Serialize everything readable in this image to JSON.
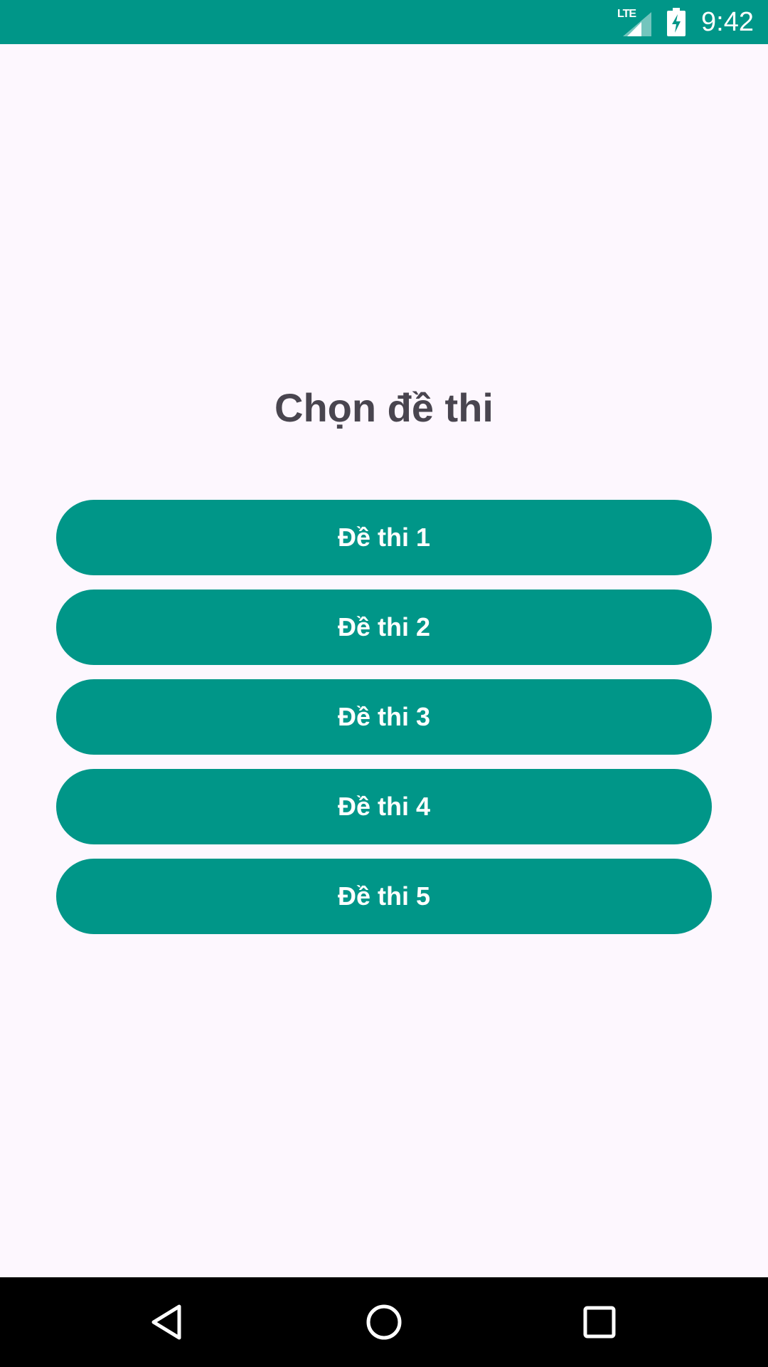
{
  "status_bar": {
    "network_label": "LTE",
    "time": "9:42",
    "color": "#009688"
  },
  "screen": {
    "title": "Chọn đề thi",
    "buttons": [
      {
        "label": "Đề thi 1"
      },
      {
        "label": "Đề thi 2"
      },
      {
        "label": "Đề thi 3"
      },
      {
        "label": "Đề thi 4"
      },
      {
        "label": "Đề thi 5"
      }
    ],
    "accent_color": "#009688",
    "background_color": "#fdf7fe"
  },
  "nav_bar": {
    "icons": [
      "back-icon",
      "home-icon",
      "recents-icon"
    ]
  }
}
